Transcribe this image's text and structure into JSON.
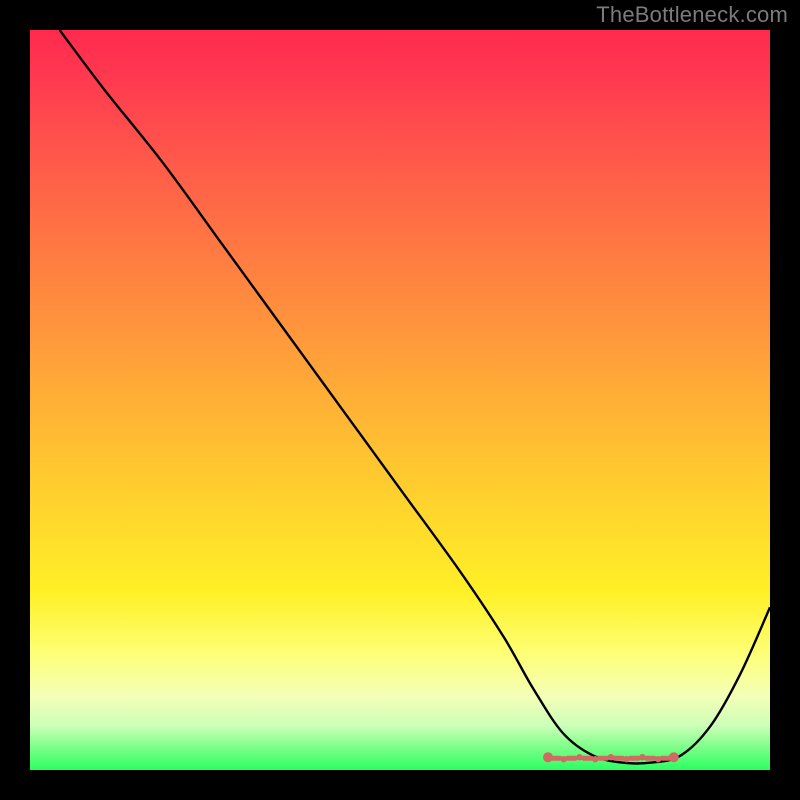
{
  "watermark": "TheBottleneck.com",
  "chart_data": {
    "type": "line",
    "title": "",
    "xlabel": "",
    "ylabel": "",
    "xlim": [
      0,
      100
    ],
    "ylim": [
      0,
      100
    ],
    "grid": false,
    "series": [
      {
        "name": "bottleneck-curve",
        "x": [
          4,
          10,
          18,
          26,
          34,
          42,
          50,
          58,
          64,
          68,
          72,
          76,
          80,
          84,
          88,
          92,
          96,
          100
        ],
        "values": [
          100,
          92,
          82,
          71,
          60,
          49,
          38,
          27,
          18,
          11,
          5,
          2,
          1,
          1,
          2,
          6,
          13,
          22
        ]
      }
    ],
    "annotations": {
      "optimal_zone": {
        "x_start": 70,
        "x_end": 87,
        "y": 2
      }
    }
  },
  "colors": {
    "frame": "#000000",
    "curve": "#000000",
    "optimal_marker": "#d16a62",
    "watermark": "#7b7b7b"
  }
}
